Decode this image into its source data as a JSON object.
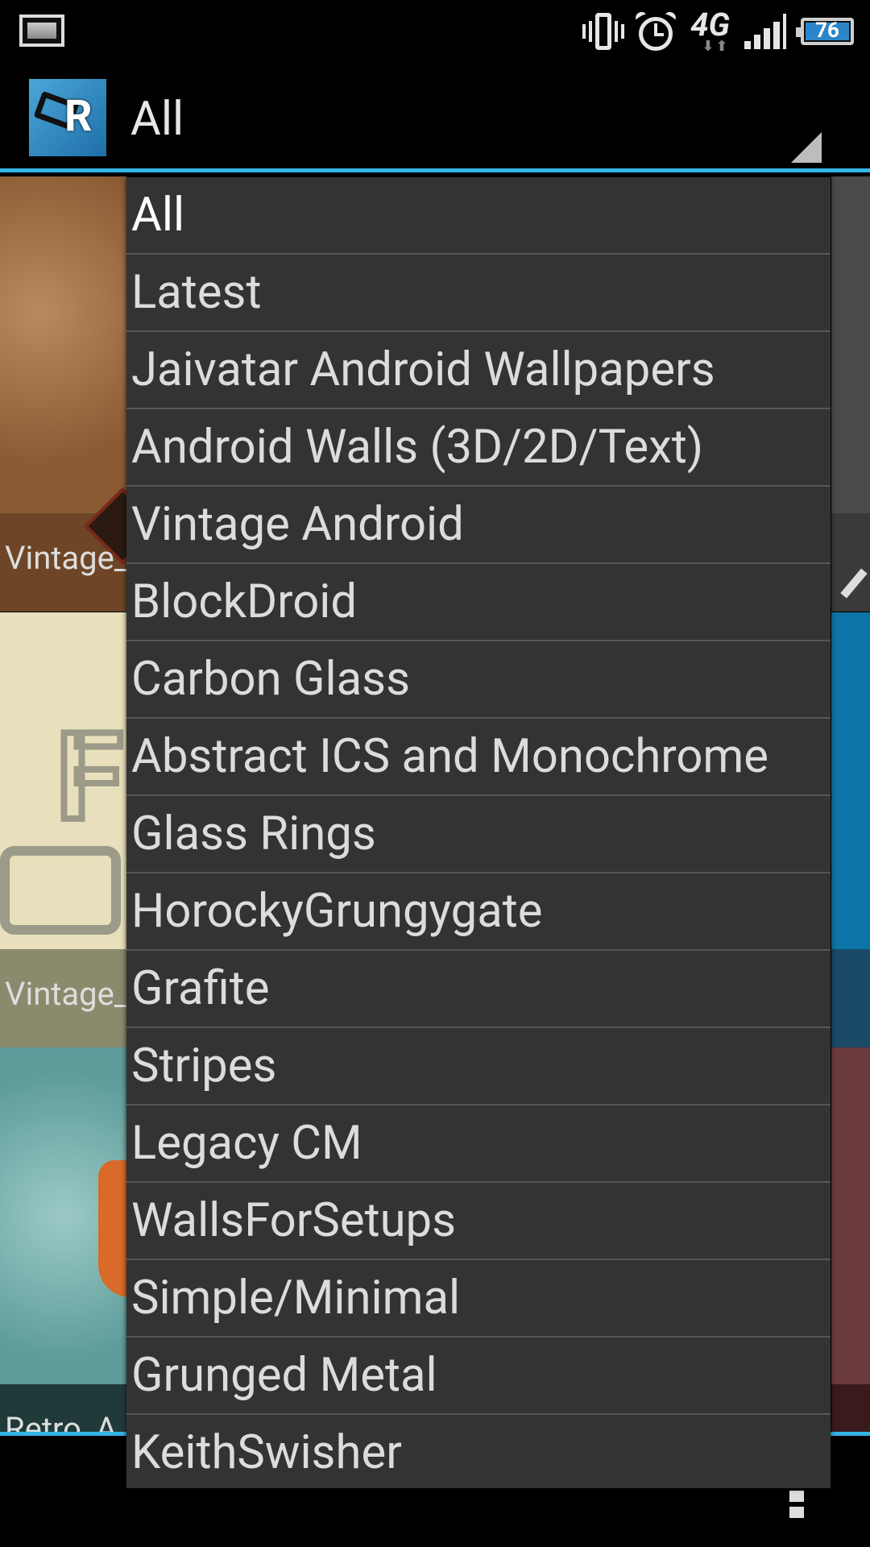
{
  "status_bar": {
    "battery_level": "76",
    "network_type": "4G",
    "icons": [
      "screenshot-icon",
      "vibrate-icon",
      "alarm-icon",
      "network-4g-icon",
      "signal-icon",
      "battery-icon"
    ]
  },
  "action_bar": {
    "spinner_selected": "All"
  },
  "background_tiles": [
    {
      "caption": "Vintage_",
      "color": "#8a5a33"
    },
    {
      "caption": "Vintage_",
      "color": "#e8e0bc"
    },
    {
      "caption": "Retro_A",
      "color": "#6fa9a8"
    }
  ],
  "dropdown": {
    "options": [
      "All",
      "Latest",
      "Jaivatar Android Wallpapers",
      "Android Walls (3D/2D/Text)",
      "Vintage Android",
      "BlockDroid",
      "Carbon Glass",
      "Abstract ICS and Monochrome",
      "Glass Rings",
      "HorockyGrungygate",
      "Grafite",
      "Stripes",
      "Legacy CM",
      "WallsForSetups",
      "Simple/Minimal",
      "Grunged Metal",
      "KeithSwisher"
    ],
    "selected": "All"
  },
  "colors": {
    "accent": "#33b5e5",
    "dropdown_bg": "#333333",
    "divider": "#565656"
  }
}
